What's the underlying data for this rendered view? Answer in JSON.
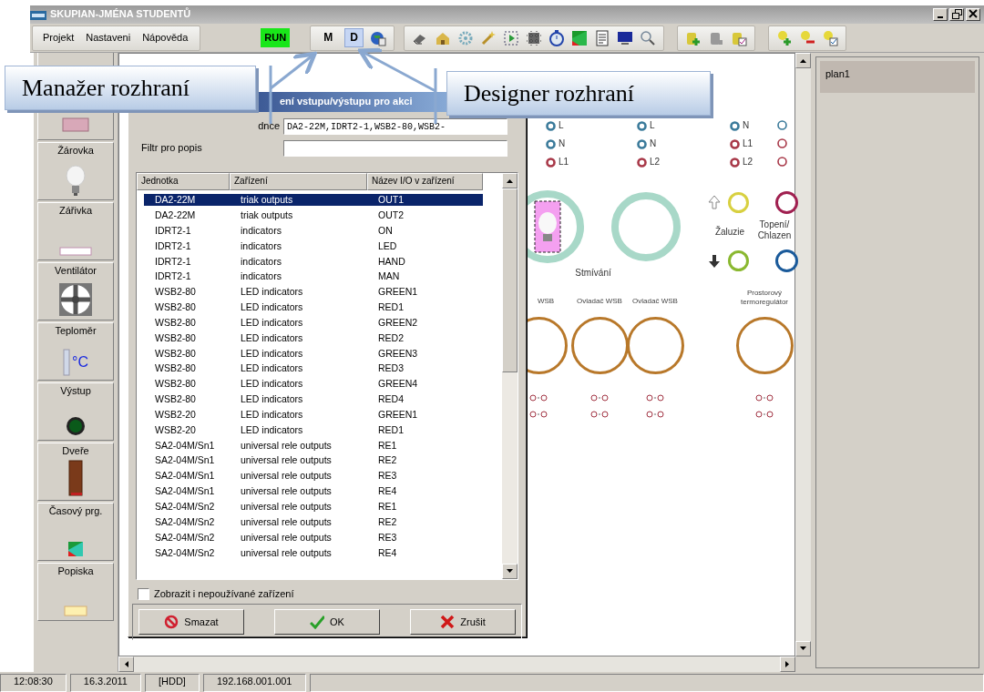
{
  "window": {
    "title": "SKUPIAN-JMÉNA STUDENTŮ"
  },
  "menu": [
    "Projekt",
    "Nastaveni",
    "Nápověda"
  ],
  "toolbar": {
    "run": "RUN",
    "modes": [
      {
        "label": "M",
        "selected": false
      },
      {
        "label": "D",
        "selected": true
      }
    ]
  },
  "palette": {
    "items": [
      {
        "kind": "cut"
      },
      {
        "kind": "block"
      },
      {
        "kind": "bulb",
        "label": "Žárovka"
      },
      {
        "kind": "tube",
        "label": "Zářivka"
      },
      {
        "kind": "fan",
        "label": "Ventilátor"
      },
      {
        "kind": "thermo",
        "label": "Teploměr",
        "icon_text": "°C"
      },
      {
        "kind": "led",
        "label": "Výstup"
      },
      {
        "kind": "door",
        "label": "Dveře"
      },
      {
        "kind": "schedule",
        "label": "Časový prg."
      },
      {
        "kind": "note",
        "label": "Popiska"
      }
    ]
  },
  "canvas": {
    "terminal_columns": [
      [
        {
          "label": "L",
          "color": "#3a7a9a"
        },
        {
          "label": "N",
          "color": "#3a7a9a"
        },
        {
          "label": "L1",
          "color": "#a83848"
        }
      ],
      [
        {
          "label": "L",
          "color": "#3a7a9a"
        },
        {
          "label": "N",
          "color": "#3a7a9a"
        },
        {
          "label": "L2",
          "color": "#a83848"
        }
      ],
      [
        {
          "label": "N",
          "color": "#3a7a9a"
        },
        {
          "label": "L1",
          "color": "#a83848"
        },
        {
          "label": "L2",
          "color": "#a83848"
        }
      ]
    ],
    "captions": [
      "Stmívání",
      "Žaluzie",
      "Topení/ Chlazen"
    ],
    "widget_titles": [
      "WSB",
      "Ovladač WSB",
      "Ovladač WSB",
      "Prostorový termoregulátor"
    ]
  },
  "dialog": {
    "title": "ení vstupu/výstupu pro akci",
    "fields": [
      {
        "label": "dnce",
        "value": "DA2-22M,IDRT2-1,WSB2-80,WSB2-"
      },
      {
        "label": "Filtr pro popis"
      }
    ],
    "table": {
      "columns": [
        "Jednotka",
        "Zařízení",
        "Název I/O v zařízení"
      ],
      "rows": [
        {
          "cells": [
            "DA2-22M",
            "triak outputs",
            "OUT1"
          ],
          "selected": true
        },
        {
          "cells": [
            "DA2-22M",
            "triak outputs",
            "OUT2"
          ],
          "selected": false
        },
        {
          "cells": [
            "IDRT2-1",
            "indicators",
            "ON"
          ],
          "selected": false
        },
        {
          "cells": [
            "IDRT2-1",
            "indicators",
            "LED"
          ],
          "selected": false
        },
        {
          "cells": [
            "IDRT2-1",
            "indicators",
            "HAND"
          ],
          "selected": false
        },
        {
          "cells": [
            "IDRT2-1",
            "indicators",
            "MAN"
          ],
          "selected": false
        },
        {
          "cells": [
            "WSB2-80",
            "LED indicators",
            "GREEN1"
          ],
          "selected": false
        },
        {
          "cells": [
            "WSB2-80",
            "LED indicators",
            "RED1"
          ],
          "selected": false
        },
        {
          "cells": [
            "WSB2-80",
            "LED indicators",
            "GREEN2"
          ],
          "selected": false
        },
        {
          "cells": [
            "WSB2-80",
            "LED indicators",
            "RED2"
          ],
          "selected": false
        },
        {
          "cells": [
            "WSB2-80",
            "LED indicators",
            "GREEN3"
          ],
          "selected": false
        },
        {
          "cells": [
            "WSB2-80",
            "LED indicators",
            "RED3"
          ],
          "selected": false
        },
        {
          "cells": [
            "WSB2-80",
            "LED indicators",
            "GREEN4"
          ],
          "selected": false
        },
        {
          "cells": [
            "WSB2-80",
            "LED indicators",
            "RED4"
          ],
          "selected": false
        },
        {
          "cells": [
            "WSB2-20",
            "LED indicators",
            "GREEN1"
          ],
          "selected": false
        },
        {
          "cells": [
            "WSB2-20",
            "LED indicators",
            "RED1"
          ],
          "selected": false
        },
        {
          "cells": [
            "SA2-04M/Sn1",
            "universal rele outputs",
            "RE1"
          ],
          "selected": false
        },
        {
          "cells": [
            "SA2-04M/Sn1",
            "universal rele outputs",
            "RE2"
          ],
          "selected": false
        },
        {
          "cells": [
            "SA2-04M/Sn1",
            "universal rele outputs",
            "RE3"
          ],
          "selected": false
        },
        {
          "cells": [
            "SA2-04M/Sn1",
            "universal rele outputs",
            "RE4"
          ],
          "selected": false
        },
        {
          "cells": [
            "SA2-04M/Sn2",
            "universal rele outputs",
            "RE1"
          ],
          "selected": false
        },
        {
          "cells": [
            "SA2-04M/Sn2",
            "universal rele outputs",
            "RE2"
          ],
          "selected": false
        },
        {
          "cells": [
            "SA2-04M/Sn2",
            "universal rele outputs",
            "RE3"
          ],
          "selected": false
        },
        {
          "cells": [
            "SA2-04M/Sn2",
            "universal rele outputs",
            "RE4"
          ],
          "selected": false
        }
      ]
    },
    "show_unused": {
      "label": "Zobrazit i nepoužívané zařízení",
      "checked": false
    },
    "buttons": [
      {
        "label": "Smazat",
        "kind": "delete"
      },
      {
        "label": "OK",
        "kind": "ok"
      },
      {
        "label": "Zrušit",
        "kind": "cancel"
      }
    ]
  },
  "plans": [
    {
      "label": "plan1",
      "selected": true
    }
  ],
  "status_bar": [
    "12:08:30",
    "16.3.2011",
    "[HDD]",
    "192.168.001.001"
  ],
  "callouts": [
    "Manažer rozhraní",
    "Designer rozhraní"
  ]
}
